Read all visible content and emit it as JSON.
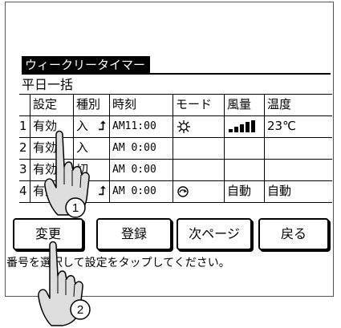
{
  "screen": {
    "title": "ウィークリータイマー",
    "subtitle": "平日一括"
  },
  "table": {
    "headers": [
      "",
      "設定",
      "種別",
      "時刻",
      "モード",
      "風量",
      "温度"
    ],
    "rows": [
      {
        "no": "1",
        "setting": "有効",
        "type": "入",
        "arrow": true,
        "time": "AM11:00",
        "mode_icon": "sun-icon",
        "fan_icon": "fan-bars-icon",
        "fan": "",
        "temp": "23℃"
      },
      {
        "no": "2",
        "setting": "有効",
        "type": "入",
        "arrow": false,
        "time": "AM 0:00",
        "mode_icon": "",
        "fan_icon": "",
        "fan": "",
        "temp": ""
      },
      {
        "no": "3",
        "setting": "有効",
        "type": "切",
        "arrow": false,
        "time": "AM 0:00",
        "mode_icon": "",
        "fan_icon": "",
        "fan": "",
        "temp": ""
      },
      {
        "no": "4",
        "setting": "有効",
        "type": "入",
        "arrow": true,
        "time": "AM 0:00",
        "mode_icon": "cycle-icon",
        "fan_icon": "",
        "fan": "自動",
        "temp": "自動"
      }
    ]
  },
  "buttons": {
    "change": "変更",
    "register": "登録",
    "next_page": "次ページ",
    "back": "戻る"
  },
  "instruction": "番号を選択して設定をタップしてください。",
  "callouts": {
    "step1": "1",
    "step2": "2"
  }
}
